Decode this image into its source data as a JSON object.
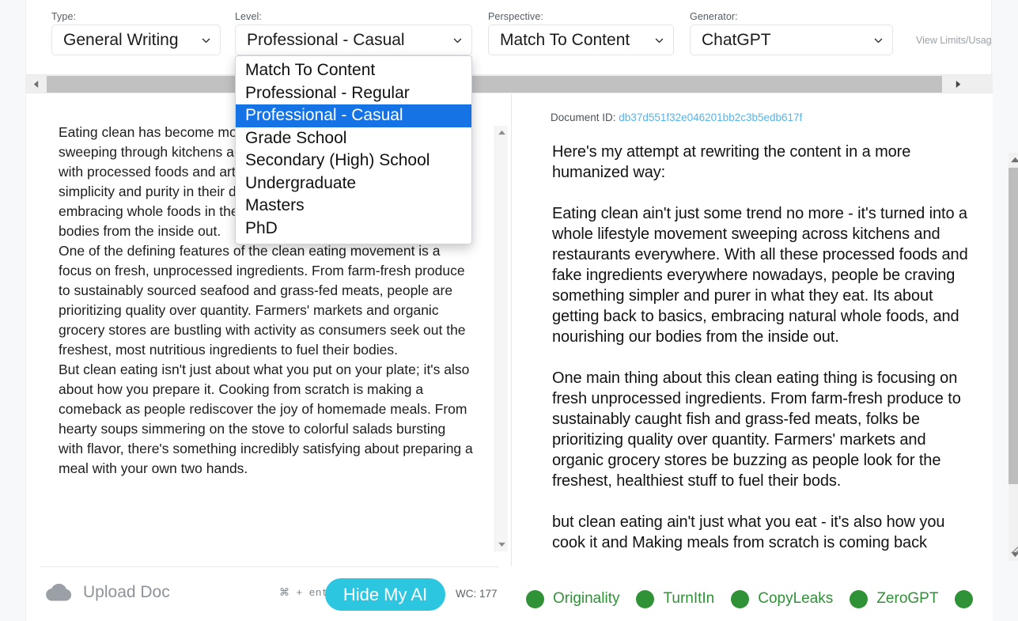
{
  "toolbar": {
    "type": {
      "label": "Type:",
      "value": "General Writing"
    },
    "level": {
      "label": "Level:",
      "value": "Professional - Casual"
    },
    "perspective": {
      "label": "Perspective:",
      "value": "Match To Content"
    },
    "generator": {
      "label": "Generator:",
      "value": "ChatGPT"
    },
    "view_limits": "View Limits/Usag"
  },
  "level_dropdown": {
    "selected": "Professional - Casual",
    "options": [
      "Match To Content",
      "Professional - Regular",
      "Professional - Casual",
      "Grade School",
      "Secondary (High) School",
      "Undergraduate",
      "Masters",
      "PhD"
    ]
  },
  "source": {
    "paragraphs": [
      "Eating clean has become more than just a trend; it's a revolution sweeping through kitchens and restaurants. In a world bombarded with processed foods and artificial ingredients, people are craving simplicity and purity in their diets. It's about getting back to basics, embracing whole foods in their natural state, and nourishing our bodies from the inside out.",
      "One of the defining features of the clean eating movement is a focus on fresh, unprocessed ingredients. From farm-fresh produce to sustainably sourced seafood and grass-fed meats, people are prioritizing quality over quantity. Farmers' markets and organic grocery stores are bustling with activity as consumers seek out the freshest, most nutritious ingredients to fuel their bodies.",
      "But clean eating isn't just about what you put on your plate; it's also about how you prepare it. Cooking from scratch is making a comeback as people rediscover the joy of homemade meals. From hearty soups simmering on the stove to colorful salads bursting with flavor, there's something incredibly satisfying about preparing a meal with your own two hands."
    ]
  },
  "output": {
    "doc_id_label": "Document ID:",
    "doc_id_value": "db37d551f32e046201bb2c3b5edb617f",
    "paragraphs": [
      "Here's my attempt at rewriting the content in a more humanized way:",
      "Eating clean ain't just some trend no more - it's turned into a whole lifestyle movement sweeping across kitchens and restaurants everywhere.  With all these processed foods and fake ingredients everywhere nowadays, people be craving something simpler and purer in what they eat.  Its about getting back to basics, embracing natural whole foods, and nourishing our bodies from the inside out.",
      "One main thing about this clean eating thing is focusing on fresh unprocessed ingredients.  From farm-fresh produce to sustainably caught fish and grass-fed meats, folks be prioritizing quality over quantity.  Farmers' markets and organic grocery stores be buzzing as people look for the freshest, healthiest stuff to fuel their bods.",
      "but clean eating ain't just what you eat - it's also how you cook it  and  Making meals from scratch is coming back"
    ]
  },
  "bottom": {
    "upload_label": "Upload Doc",
    "shortcut": "⌘ + enter",
    "hide_button": "Hide My AI",
    "word_count": "WC: 177",
    "detectors": [
      {
        "name": "Originality",
        "status": "pass"
      },
      {
        "name": "TurnItIn",
        "status": "pass"
      },
      {
        "name": "CopyLeaks",
        "status": "pass"
      },
      {
        "name": "ZeroGPT",
        "status": "pass"
      },
      {
        "name": "",
        "status": "pass"
      }
    ]
  },
  "colors": {
    "accent_teal": "#2cc6e0",
    "detector_green": "#2f9236",
    "highlight_blue": "#1673e6",
    "link_blue": "#56b4e8"
  }
}
